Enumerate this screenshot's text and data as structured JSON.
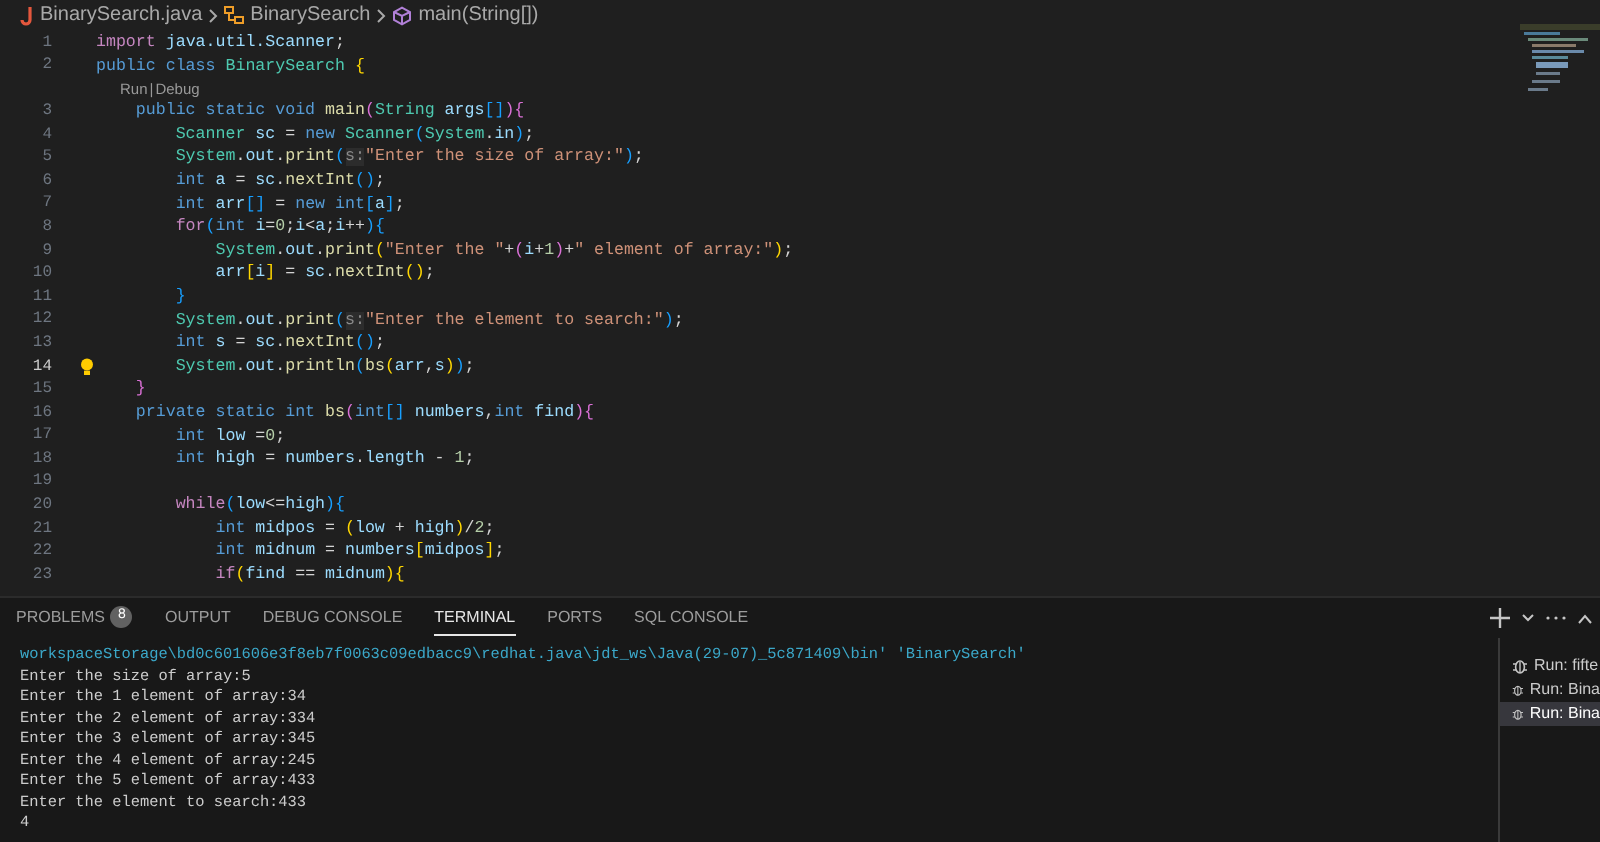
{
  "breadcrumb": {
    "file": "BinarySearch.java",
    "class": "BinarySearch",
    "method": "main(String[])"
  },
  "editor": {
    "lines": [
      {
        "kind": "code",
        "number": "1",
        "current": false,
        "tokens": [
          {
            "kind": "ctl",
            "text": "import "
          },
          {
            "kind": "var",
            "text": "java.util.Scanner"
          },
          {
            "kind": "p",
            "text": ";"
          }
        ]
      },
      {
        "kind": "code",
        "number": "2",
        "current": false,
        "tokens": [
          {
            "kind": "kw",
            "text": "public class "
          },
          {
            "kind": "type",
            "text": "BinarySearch "
          },
          {
            "kind": "b1",
            "text": "{"
          }
        ]
      },
      {
        "kind": "codelens",
        "links": [
          "Run",
          "Debug"
        ],
        "separator": "|"
      },
      {
        "kind": "code",
        "number": "3",
        "current": false,
        "tokens": [
          {
            "kind": "kw",
            "text": "    public static void "
          },
          {
            "kind": "fn",
            "text": "main"
          },
          {
            "kind": "b2",
            "text": "("
          },
          {
            "kind": "type",
            "text": "String "
          },
          {
            "kind": "var",
            "text": "args"
          },
          {
            "kind": "b3",
            "text": "[]"
          },
          {
            "kind": "b2",
            "text": "){"
          }
        ]
      },
      {
        "kind": "code",
        "number": "4",
        "current": false,
        "tokens": [
          {
            "kind": "type",
            "text": "        Scanner "
          },
          {
            "kind": "var",
            "text": "sc"
          },
          {
            "kind": "p",
            "text": " = "
          },
          {
            "kind": "kw",
            "text": "new "
          },
          {
            "kind": "type",
            "text": "Scanner"
          },
          {
            "kind": "b3",
            "text": "("
          },
          {
            "kind": "type",
            "text": "System"
          },
          {
            "kind": "p",
            "text": "."
          },
          {
            "kind": "var",
            "text": "in"
          },
          {
            "kind": "b3",
            "text": ")"
          },
          {
            "kind": "p",
            "text": ";"
          }
        ]
      },
      {
        "kind": "code",
        "number": "5",
        "current": false,
        "tokens": [
          {
            "kind": "type",
            "text": "        System"
          },
          {
            "kind": "p",
            "text": "."
          },
          {
            "kind": "var",
            "text": "out"
          },
          {
            "kind": "p",
            "text": "."
          },
          {
            "kind": "fn",
            "text": "print"
          },
          {
            "kind": "b3",
            "text": "("
          },
          {
            "kind": "hint",
            "text": "s:"
          },
          {
            "kind": "str",
            "text": "\"Enter the size of array:\""
          },
          {
            "kind": "b3",
            "text": ")"
          },
          {
            "kind": "p",
            "text": ";"
          }
        ]
      },
      {
        "kind": "code",
        "number": "6",
        "current": false,
        "tokens": [
          {
            "kind": "kw",
            "text": "        int "
          },
          {
            "kind": "var",
            "text": "a"
          },
          {
            "kind": "p",
            "text": " = "
          },
          {
            "kind": "var",
            "text": "sc"
          },
          {
            "kind": "p",
            "text": "."
          },
          {
            "kind": "fn",
            "text": "nextInt"
          },
          {
            "kind": "b3",
            "text": "()"
          },
          {
            "kind": "p",
            "text": ";"
          }
        ]
      },
      {
        "kind": "code",
        "number": "7",
        "current": false,
        "tokens": [
          {
            "kind": "kw",
            "text": "        int "
          },
          {
            "kind": "var",
            "text": "arr"
          },
          {
            "kind": "b3",
            "text": "[]"
          },
          {
            "kind": "p",
            "text": " = "
          },
          {
            "kind": "kw",
            "text": "new int"
          },
          {
            "kind": "b3",
            "text": "["
          },
          {
            "kind": "var",
            "text": "a"
          },
          {
            "kind": "b3",
            "text": "]"
          },
          {
            "kind": "p",
            "text": ";"
          }
        ]
      },
      {
        "kind": "code",
        "number": "8",
        "current": false,
        "tokens": [
          {
            "kind": "ctl",
            "text": "        for"
          },
          {
            "kind": "b3",
            "text": "("
          },
          {
            "kind": "kw",
            "text": "int "
          },
          {
            "kind": "var",
            "text": "i"
          },
          {
            "kind": "p",
            "text": "="
          },
          {
            "kind": "num",
            "text": "0"
          },
          {
            "kind": "p",
            "text": ";"
          },
          {
            "kind": "var",
            "text": "i"
          },
          {
            "kind": "p",
            "text": "<"
          },
          {
            "kind": "var",
            "text": "a"
          },
          {
            "kind": "p",
            "text": ";"
          },
          {
            "kind": "var",
            "text": "i"
          },
          {
            "kind": "p",
            "text": "++"
          },
          {
            "kind": "b3",
            "text": "){"
          }
        ]
      },
      {
        "kind": "code",
        "number": "9",
        "current": false,
        "tokens": [
          {
            "kind": "type",
            "text": "            System"
          },
          {
            "kind": "p",
            "text": "."
          },
          {
            "kind": "var",
            "text": "out"
          },
          {
            "kind": "p",
            "text": "."
          },
          {
            "kind": "fn",
            "text": "print"
          },
          {
            "kind": "b1",
            "text": "("
          },
          {
            "kind": "str",
            "text": "\"Enter the \""
          },
          {
            "kind": "p",
            "text": "+"
          },
          {
            "kind": "b2",
            "text": "("
          },
          {
            "kind": "var",
            "text": "i"
          },
          {
            "kind": "p",
            "text": "+"
          },
          {
            "kind": "num",
            "text": "1"
          },
          {
            "kind": "b2",
            "text": ")"
          },
          {
            "kind": "p",
            "text": "+"
          },
          {
            "kind": "str",
            "text": "\" element of array:\""
          },
          {
            "kind": "b1",
            "text": ")"
          },
          {
            "kind": "p",
            "text": ";"
          }
        ]
      },
      {
        "kind": "code",
        "number": "10",
        "current": false,
        "tokens": [
          {
            "kind": "var",
            "text": "            arr"
          },
          {
            "kind": "b1",
            "text": "["
          },
          {
            "kind": "var",
            "text": "i"
          },
          {
            "kind": "b1",
            "text": "]"
          },
          {
            "kind": "p",
            "text": " = "
          },
          {
            "kind": "var",
            "text": "sc"
          },
          {
            "kind": "p",
            "text": "."
          },
          {
            "kind": "fn",
            "text": "nextInt"
          },
          {
            "kind": "b1",
            "text": "()"
          },
          {
            "kind": "p",
            "text": ";"
          }
        ]
      },
      {
        "kind": "code",
        "number": "11",
        "current": false,
        "tokens": [
          {
            "kind": "b3",
            "text": "        }"
          }
        ]
      },
      {
        "kind": "code",
        "number": "12",
        "current": false,
        "tokens": [
          {
            "kind": "type",
            "text": "        System"
          },
          {
            "kind": "p",
            "text": "."
          },
          {
            "kind": "var",
            "text": "out"
          },
          {
            "kind": "p",
            "text": "."
          },
          {
            "kind": "fn",
            "text": "print"
          },
          {
            "kind": "b3",
            "text": "("
          },
          {
            "kind": "hint",
            "text": "s:"
          },
          {
            "kind": "str",
            "text": "\"Enter the element to search:\""
          },
          {
            "kind": "b3",
            "text": ")"
          },
          {
            "kind": "p",
            "text": ";"
          }
        ]
      },
      {
        "kind": "code",
        "number": "13",
        "current": false,
        "tokens": [
          {
            "kind": "kw",
            "text": "        int "
          },
          {
            "kind": "var",
            "text": "s"
          },
          {
            "kind": "p",
            "text": " = "
          },
          {
            "kind": "var",
            "text": "sc"
          },
          {
            "kind": "p",
            "text": "."
          },
          {
            "kind": "fn",
            "text": "nextInt"
          },
          {
            "kind": "b3",
            "text": "()"
          },
          {
            "kind": "p",
            "text": ";"
          }
        ]
      },
      {
        "kind": "code",
        "number": "14",
        "current": true,
        "tokens": [
          {
            "kind": "type",
            "text": "        System"
          },
          {
            "kind": "p",
            "text": "."
          },
          {
            "kind": "var",
            "text": "out"
          },
          {
            "kind": "p",
            "text": "."
          },
          {
            "kind": "fn",
            "text": "println"
          },
          {
            "kind": "b3",
            "text": "("
          },
          {
            "kind": "fn",
            "text": "bs"
          },
          {
            "kind": "b1",
            "text": "("
          },
          {
            "kind": "var",
            "text": "arr"
          },
          {
            "kind": "p",
            "text": ","
          },
          {
            "kind": "var",
            "text": "s"
          },
          {
            "kind": "b1",
            "text": ")"
          },
          {
            "kind": "b3",
            "text": ")"
          },
          {
            "kind": "p",
            "text": ";"
          }
        ]
      },
      {
        "kind": "code",
        "number": "15",
        "current": false,
        "tokens": [
          {
            "kind": "b2",
            "text": "    }"
          }
        ]
      },
      {
        "kind": "code",
        "number": "16",
        "current": false,
        "tokens": [
          {
            "kind": "kw",
            "text": "    private static int "
          },
          {
            "kind": "fn",
            "text": "bs"
          },
          {
            "kind": "b2",
            "text": "("
          },
          {
            "kind": "kw",
            "text": "int"
          },
          {
            "kind": "b3",
            "text": "[]"
          },
          {
            "kind": "var",
            "text": " numbers"
          },
          {
            "kind": "p",
            "text": ","
          },
          {
            "kind": "kw",
            "text": "int "
          },
          {
            "kind": "var",
            "text": "find"
          },
          {
            "kind": "b2",
            "text": "){"
          }
        ]
      },
      {
        "kind": "code",
        "number": "17",
        "current": false,
        "tokens": [
          {
            "kind": "kw",
            "text": "        int "
          },
          {
            "kind": "var",
            "text": "low"
          },
          {
            "kind": "p",
            "text": " ="
          },
          {
            "kind": "num",
            "text": "0"
          },
          {
            "kind": "p",
            "text": ";"
          }
        ]
      },
      {
        "kind": "code",
        "number": "18",
        "current": false,
        "tokens": [
          {
            "kind": "kw",
            "text": "        int "
          },
          {
            "kind": "var",
            "text": "high"
          },
          {
            "kind": "p",
            "text": " = "
          },
          {
            "kind": "var",
            "text": "numbers"
          },
          {
            "kind": "p",
            "text": "."
          },
          {
            "kind": "var",
            "text": "length"
          },
          {
            "kind": "p",
            "text": " - "
          },
          {
            "kind": "num",
            "text": "1"
          },
          {
            "kind": "p",
            "text": ";"
          }
        ]
      },
      {
        "kind": "code",
        "number": "19",
        "current": false
      },
      {
        "kind": "code",
        "number": "20",
        "current": false,
        "tokens": [
          {
            "kind": "ctl",
            "text": "        while"
          },
          {
            "kind": "b3",
            "text": "("
          },
          {
            "kind": "var",
            "text": "low"
          },
          {
            "kind": "p",
            "text": "<="
          },
          {
            "kind": "var",
            "text": "high"
          },
          {
            "kind": "b3",
            "text": "){"
          }
        ]
      },
      {
        "kind": "code",
        "number": "21",
        "current": false,
        "tokens": [
          {
            "kind": "kw",
            "text": "            int "
          },
          {
            "kind": "var",
            "text": "midpos"
          },
          {
            "kind": "p",
            "text": " = "
          },
          {
            "kind": "b1",
            "text": "("
          },
          {
            "kind": "var",
            "text": "low"
          },
          {
            "kind": "p",
            "text": " + "
          },
          {
            "kind": "var",
            "text": "high"
          },
          {
            "kind": "b1",
            "text": ")"
          },
          {
            "kind": "p",
            "text": "/"
          },
          {
            "kind": "num",
            "text": "2"
          },
          {
            "kind": "p",
            "text": ";"
          }
        ]
      },
      {
        "kind": "code",
        "number": "22",
        "current": false,
        "tokens": [
          {
            "kind": "kw",
            "text": "            int "
          },
          {
            "kind": "var",
            "text": "midnum"
          },
          {
            "kind": "p",
            "text": " = "
          },
          {
            "kind": "var",
            "text": "numbers"
          },
          {
            "kind": "b1",
            "text": "["
          },
          {
            "kind": "var",
            "text": "midpos"
          },
          {
            "kind": "b1",
            "text": "]"
          },
          {
            "kind": "p",
            "text": ";"
          }
        ]
      },
      {
        "kind": "code",
        "number": "23",
        "current": false,
        "tokens": [
          {
            "kind": "ctl",
            "text": "            if"
          },
          {
            "kind": "b1",
            "text": "("
          },
          {
            "kind": "var",
            "text": "find"
          },
          {
            "kind": "p",
            "text": " == "
          },
          {
            "kind": "var",
            "text": "midnum"
          },
          {
            "kind": "b1",
            "text": "){"
          }
        ]
      }
    ]
  },
  "panel": {
    "tabs": [
      {
        "label": "PROBLEMS",
        "badge": "8",
        "selected": false
      },
      {
        "label": "OUTPUT",
        "selected": false
      },
      {
        "label": "DEBUG CONSOLE",
        "selected": false
      },
      {
        "label": "TERMINAL",
        "selected": true
      },
      {
        "label": "PORTS",
        "selected": false
      },
      {
        "label": "SQL CONSOLE",
        "selected": false
      }
    ],
    "terminal_lines": [
      {
        "kind": "path",
        "text": "workspaceStorage\\bd0c601606e3f8eb7f0063c09edbacc9\\redhat.java\\jdt_ws\\Java(29-07)_5c871409\\bin' 'BinarySearch'"
      },
      {
        "kind": "output",
        "text": "Enter the size of array:5"
      },
      {
        "kind": "output",
        "text": "Enter the 1 element of array:34"
      },
      {
        "kind": "output",
        "text": "Enter the 2 element of array:334"
      },
      {
        "kind": "output",
        "text": "Enter the 3 element of array:345"
      },
      {
        "kind": "output",
        "text": "Enter the 4 element of array:245"
      },
      {
        "kind": "output",
        "text": "Enter the 5 element of array:433"
      },
      {
        "kind": "output",
        "text": "Enter the element to search:433"
      },
      {
        "kind": "output",
        "text": "4"
      }
    ],
    "terminals": [
      {
        "label": "Run: fifte",
        "selected": false
      },
      {
        "label": "Run: Bina",
        "selected": false
      },
      {
        "label": "Run: Bina",
        "selected": true
      }
    ]
  }
}
